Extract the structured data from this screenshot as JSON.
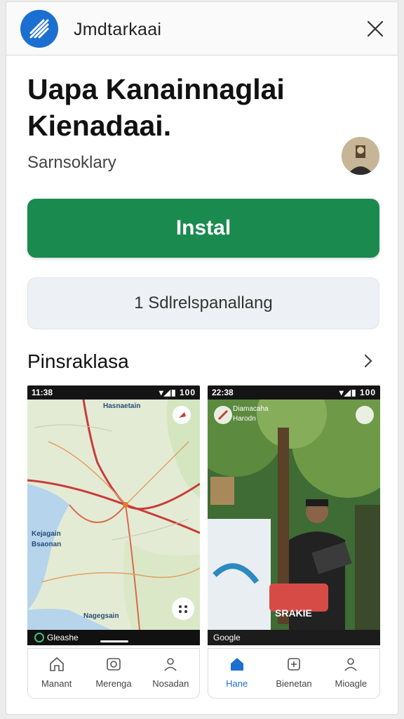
{
  "topbar": {
    "app_name": "Jmdtarkaai"
  },
  "app": {
    "title": "Uapa Kanainnaglai Kienadaai.",
    "developer": "Sarnsoklary"
  },
  "actions": {
    "install_label": "Instal",
    "secondary_label": "1 Sdlrelspanallang"
  },
  "screenshots": {
    "title": "Pinsraklasa",
    "left": {
      "status_time": "11:38",
      "status_icons": "▾◢▮ 100",
      "map_labels": [
        "Hasnaetain",
        "Kejagain",
        "Bsaonan",
        "Nagegsain"
      ],
      "footer": "Gleashe",
      "nav": [
        "Manant",
        "Merenga",
        "Nosadan"
      ]
    },
    "right": {
      "status_time": "22:38",
      "status_icons": "▾◢▮ 100",
      "overlay_title": "Diamacaha",
      "overlay_sub": "Harodn",
      "banner": "SRAKIE",
      "footer": "Google",
      "nav": [
        "Hane",
        "Bienetan",
        "Mioagle"
      ]
    }
  },
  "colors": {
    "brand": "#1b6fd0",
    "install": "#1a8a4e",
    "active_nav": "#1d6fd1"
  }
}
